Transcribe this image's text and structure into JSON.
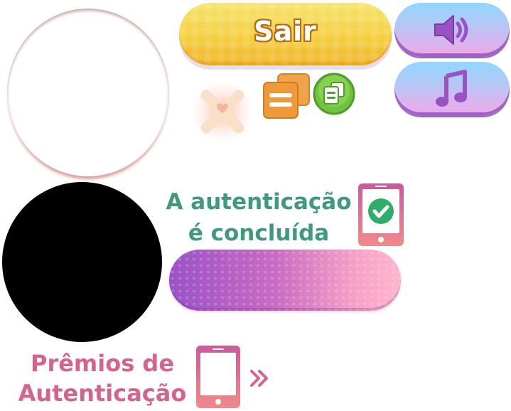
{
  "exit_button": {
    "label": "Sair"
  },
  "auth_status": {
    "line1": "A autenticação",
    "line2": "é concluída"
  },
  "auth_rewards": {
    "line1": "Prêmios de",
    "line2": "Autenticação"
  },
  "icons": {
    "sound": "speaker-icon",
    "music": "music-note-icon",
    "close": "close-x-icon",
    "copy_square": "copy-icon",
    "copy_round": "copy-round-icon",
    "phone_check": "phone-check-icon",
    "phone": "phone-icon",
    "forward": "double-chevron-right-icon"
  },
  "colors": {
    "exit_button": "#f4cf3c",
    "pill_button": "#b9c6f5",
    "auth_text": "#3f9a7b",
    "rewards_text": "#d4638f",
    "bar_start": "#9a52c9",
    "bar_end": "#ffb6cc"
  }
}
